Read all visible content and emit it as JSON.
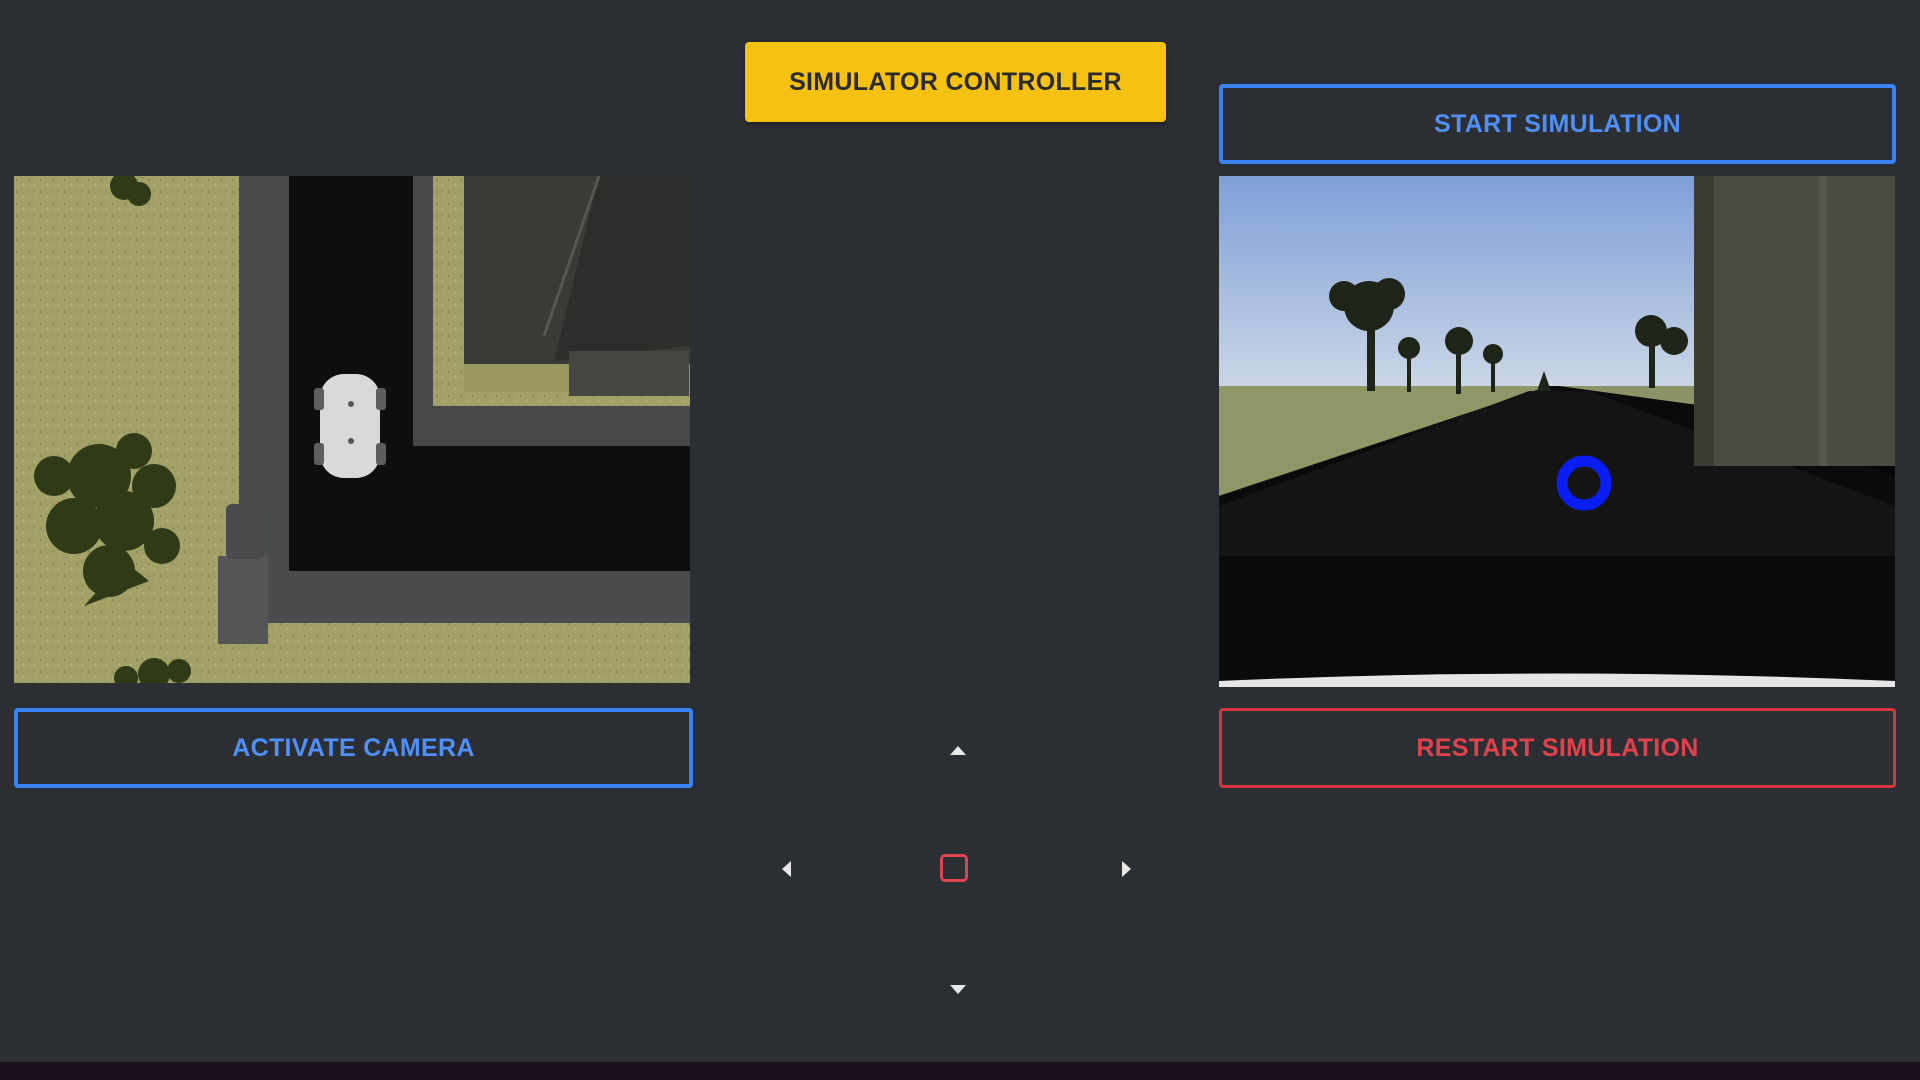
{
  "header": {
    "title_label": "SIMULATOR CONTROLLER",
    "title_color": "#f5c211"
  },
  "controls": {
    "start_label": "START SIMULATION",
    "camera_label": "ACTIVATE CAMERA",
    "restart_label": "RESTART SIMULATION",
    "primary_color": "#3b82f6",
    "danger_color": "#d6333d"
  },
  "views": {
    "top_view_icon": "overhead-map-view",
    "camera_view_icon": "front-camera-feed"
  },
  "dpad": {
    "up_icon": "arrow-up-icon",
    "down_icon": "arrow-down-icon",
    "left_icon": "arrow-left-icon",
    "right_icon": "arrow-right-icon",
    "stop_icon": "stop-icon"
  }
}
